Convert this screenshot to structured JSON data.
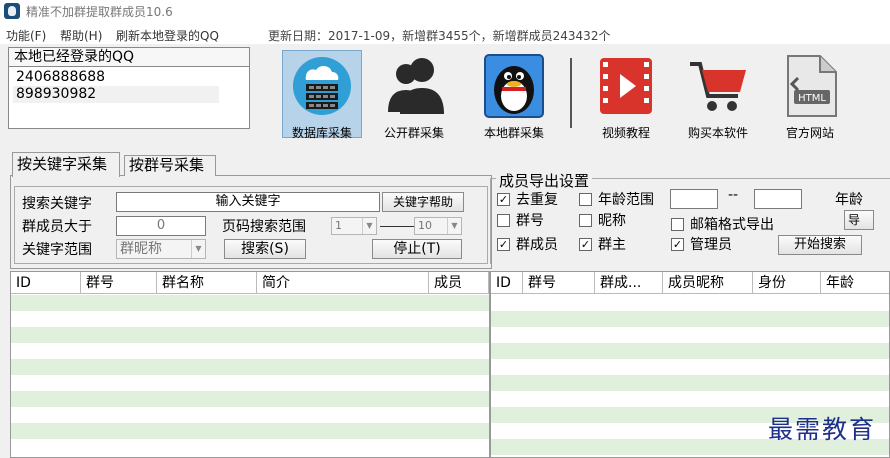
{
  "window": {
    "title": "精准不加群提取群成员10.6"
  },
  "menu": {
    "items": [
      {
        "label": "功能(F)"
      },
      {
        "label": "帮助(H)"
      },
      {
        "label": "刷新本地登录的QQ"
      }
    ],
    "update_info": "更新日期：2017-1-09，新增群3455个，新增群成员243432个"
  },
  "qq_panel": {
    "header": "本地已经登录的QQ",
    "accounts": [
      "2406888688",
      "898930982"
    ]
  },
  "toolbar": {
    "items": [
      {
        "label": "数据库采集",
        "icon": "database-cloud-icon"
      },
      {
        "label": "公开群采集",
        "icon": "users-silhouette-icon"
      },
      {
        "label": "本地群采集",
        "icon": "qq-penguin-icon"
      },
      {
        "label": "视频教程",
        "icon": "video-film-icon"
      },
      {
        "label": "购买本软件",
        "icon": "shopping-cart-icon"
      },
      {
        "label": "官方网站",
        "icon": "html-file-icon"
      }
    ]
  },
  "tabs": [
    {
      "label": "按关键字采集",
      "active": true
    },
    {
      "label": "按群号采集",
      "active": false
    }
  ],
  "search": {
    "keyword_label": "搜索关键字",
    "keyword_value": "输入关键字",
    "keyword_help_button": "关键字帮助",
    "member_min_label": "群成员大于",
    "member_min_value": "0",
    "page_range_label": "页码搜索范围",
    "page_from": "1",
    "page_to": "10",
    "range_label": "关键字范围",
    "range_value": "群昵称",
    "search_button": "搜索(S)",
    "stop_button": "停止(T)"
  },
  "export": {
    "title": "成员导出设置",
    "options": [
      {
        "label": "去重复",
        "checked": true
      },
      {
        "label": "年龄范围",
        "checked": false
      },
      {
        "label": "群号",
        "checked": false
      },
      {
        "label": "昵称",
        "checked": false
      },
      {
        "label": "邮箱格式导出",
        "checked": false
      },
      {
        "label": "群成员",
        "checked": true
      },
      {
        "label": "群主",
        "checked": true
      },
      {
        "label": "管理员",
        "checked": true
      }
    ],
    "age_separator": "--",
    "age_cut_label": "年龄",
    "export_cut_label": "导",
    "start_search_button": "开始搜索"
  },
  "group_table": {
    "columns": [
      "ID",
      "群号",
      "群名称",
      "简介",
      "成员"
    ]
  },
  "member_table": {
    "columns": [
      "ID",
      "群号",
      "群成...",
      "成员昵称",
      "身份",
      "年龄"
    ]
  },
  "watermark": "最需教育",
  "colors": {
    "stripe": "#e0f0dd",
    "selection": "#b7d3ea"
  }
}
